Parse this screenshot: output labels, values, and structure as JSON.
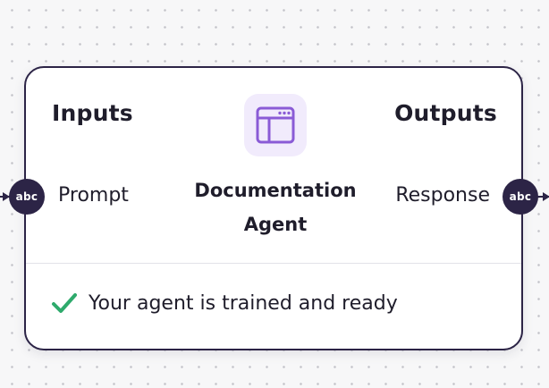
{
  "node": {
    "inputs_title": "Inputs",
    "outputs_title": "Outputs",
    "agent_name": "Documentation Agent",
    "agent_icon": "browser-window-icon",
    "input_port": {
      "label": "Prompt",
      "type_badge": "abc"
    },
    "output_port": {
      "label": "Response",
      "type_badge": "abc"
    },
    "status": {
      "icon": "check-icon",
      "text": "Your agent is trained and ready"
    }
  },
  "colors": {
    "node_border": "#2c2446",
    "icon_background": "#f1ebfc",
    "icon_accent": "#8a5bd6",
    "success": "#2eaa6c",
    "canvas": "#f7f7f8"
  }
}
